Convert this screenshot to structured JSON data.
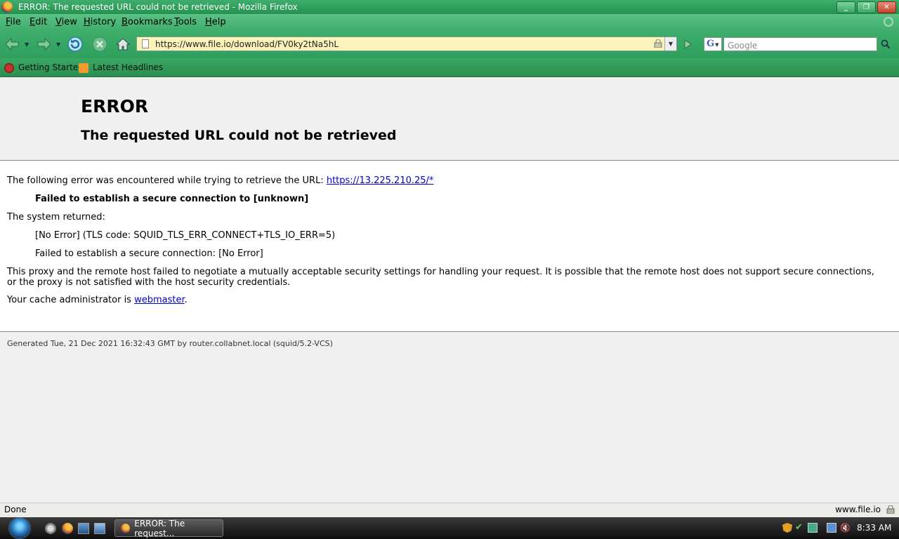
{
  "window": {
    "title": "ERROR: The requested URL could not be retrieved - Mozilla Firefox",
    "buttons": [
      "minimize",
      "maximize",
      "close"
    ]
  },
  "menu": [
    "File",
    "Edit",
    "View",
    "History",
    "Bookmarks",
    "Tools",
    "Help"
  ],
  "navigation": {
    "url": "https://www.file.io/download/FV0ky2tNa5hL",
    "search_placeholder": "Google",
    "search_engine": "G"
  },
  "bookmarks": [
    {
      "label": "Getting Started",
      "icon": "firefox-bookmark-icon"
    },
    {
      "label": "Latest Headlines",
      "icon": "rss-feed-icon"
    }
  ],
  "page": {
    "h1": "ERROR",
    "h2": "The requested URL could not be retrieved",
    "intro": "The following error was encountered while trying to retrieve the URL: ",
    "error_url": "https://13.225.210.25/*",
    "failure": "Failed to establish a secure connection to [unknown]",
    "system_returned": "The system returned:",
    "tls_code": "[No Error] (TLS code: SQUID_TLS_ERR_CONNECT+TLS_IO_ERR=5)",
    "failure_detail": "Failed to establish a secure connection: [No Error]",
    "explanation": "This proxy and the remote host failed to negotiate a mutually acceptable security settings for handling your request. It is possible that the remote host does not support secure connections, or the proxy is not satisfied with the host security credentials.",
    "admin_prefix": "Your cache administrator is ",
    "admin_link": "webmaster",
    "admin_suffix": ".",
    "footer": "Generated Tue, 21 Dec 2021 16:32:43 GMT by router.collabnet.local (squid/5.2-VCS)"
  },
  "statusbar": {
    "status": "Done",
    "host": "www.file.io"
  },
  "taskbar": {
    "task_label": "ERROR: The request...",
    "clock": "8:33 AM"
  },
  "colors": {
    "chrome_green": "#3fae6c",
    "link_blue": "#0000cc",
    "url_bar_bg": "#fbf3b9"
  }
}
